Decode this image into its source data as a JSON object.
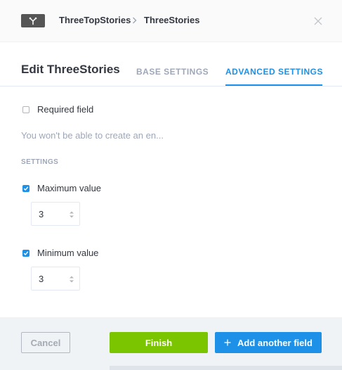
{
  "header": {
    "type_icon": "relation-icon",
    "breadcrumb": [
      "ThreeTopStories",
      "ThreeStories"
    ],
    "separator_icon": "chevron-right-icon",
    "close_icon": "close-icon"
  },
  "modal": {
    "title": "Edit ThreeStories",
    "tabs": [
      {
        "label": "BASE SETTINGS",
        "active": false
      },
      {
        "label": "ADVANCED SETTINGS",
        "active": true
      }
    ]
  },
  "advanced": {
    "required_field": {
      "label": "Required field",
      "checked": false
    },
    "description": "You won't be able to create an en...",
    "settings_title": "SETTINGS",
    "maximum": {
      "label": "Maximum value",
      "checked": true,
      "value": "3"
    },
    "minimum": {
      "label": "Minimum value",
      "checked": true,
      "value": "3"
    }
  },
  "footer": {
    "cancel_label": "Cancel",
    "finish_label": "Finish",
    "add_label": "Add another field"
  },
  "colors": {
    "accent": "#1c91e7",
    "finish": "#7bc400",
    "header_bg": "#fafafb",
    "footer_bg": "#eff3f6",
    "muted_text": "#9ea7b8"
  }
}
